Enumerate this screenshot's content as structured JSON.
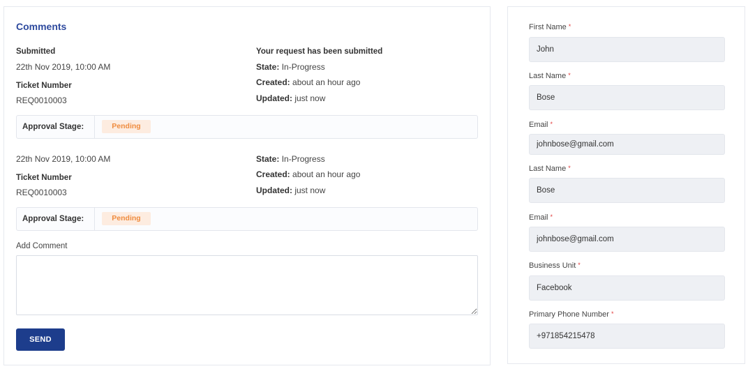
{
  "comments": {
    "title": "Comments",
    "entry1": {
      "submitted_label": "Submitted",
      "submitted_date": "22th Nov 2019, 10:00 AM",
      "ticket_label": "Ticket Number",
      "ticket_value": "REQ0010003",
      "status_heading": "Your request has been submitted",
      "state_label": "State:",
      "state_value": "In-Progress",
      "created_label": "Created:",
      "created_value": "about an hour ago",
      "updated_label": "Updated:",
      "updated_value": "just now",
      "approval_label": "Approval Stage:",
      "approval_status": "Pending"
    },
    "entry2": {
      "date": "22th Nov 2019, 10:00 AM",
      "ticket_label": "Ticket Number",
      "ticket_value": "REQ0010003",
      "state_label": "State:",
      "state_value": "In-Progress",
      "created_label": "Created:",
      "created_value": "about an hour ago",
      "updated_label": "Updated:",
      "updated_value": "just now",
      "approval_label": "Approval Stage:",
      "approval_status": "Pending"
    },
    "add_comment_label": "Add Comment",
    "add_comment_value": "",
    "send_label": "SEND"
  },
  "form": {
    "required_marker": "*",
    "fields": [
      {
        "label": "First Name",
        "value": "John"
      },
      {
        "label": "Last Name",
        "value": "Bose"
      },
      {
        "label": "Email",
        "value": "johnbose@gmail.com"
      },
      {
        "label": "Last Name",
        "value": "Bose"
      },
      {
        "label": "Email",
        "value": "johnbose@gmail.com"
      },
      {
        "label": "Business Unit",
        "value": "Facebook"
      },
      {
        "label": "Primary Phone Number",
        "value": "+971854215478"
      }
    ]
  },
  "colors": {
    "accent_title": "#2e4a9e",
    "send_button": "#1d3d8c",
    "pending_badge_bg": "#fdece0",
    "pending_badge_text": "#ef8c3f",
    "required_marker": "#e23c3c"
  }
}
